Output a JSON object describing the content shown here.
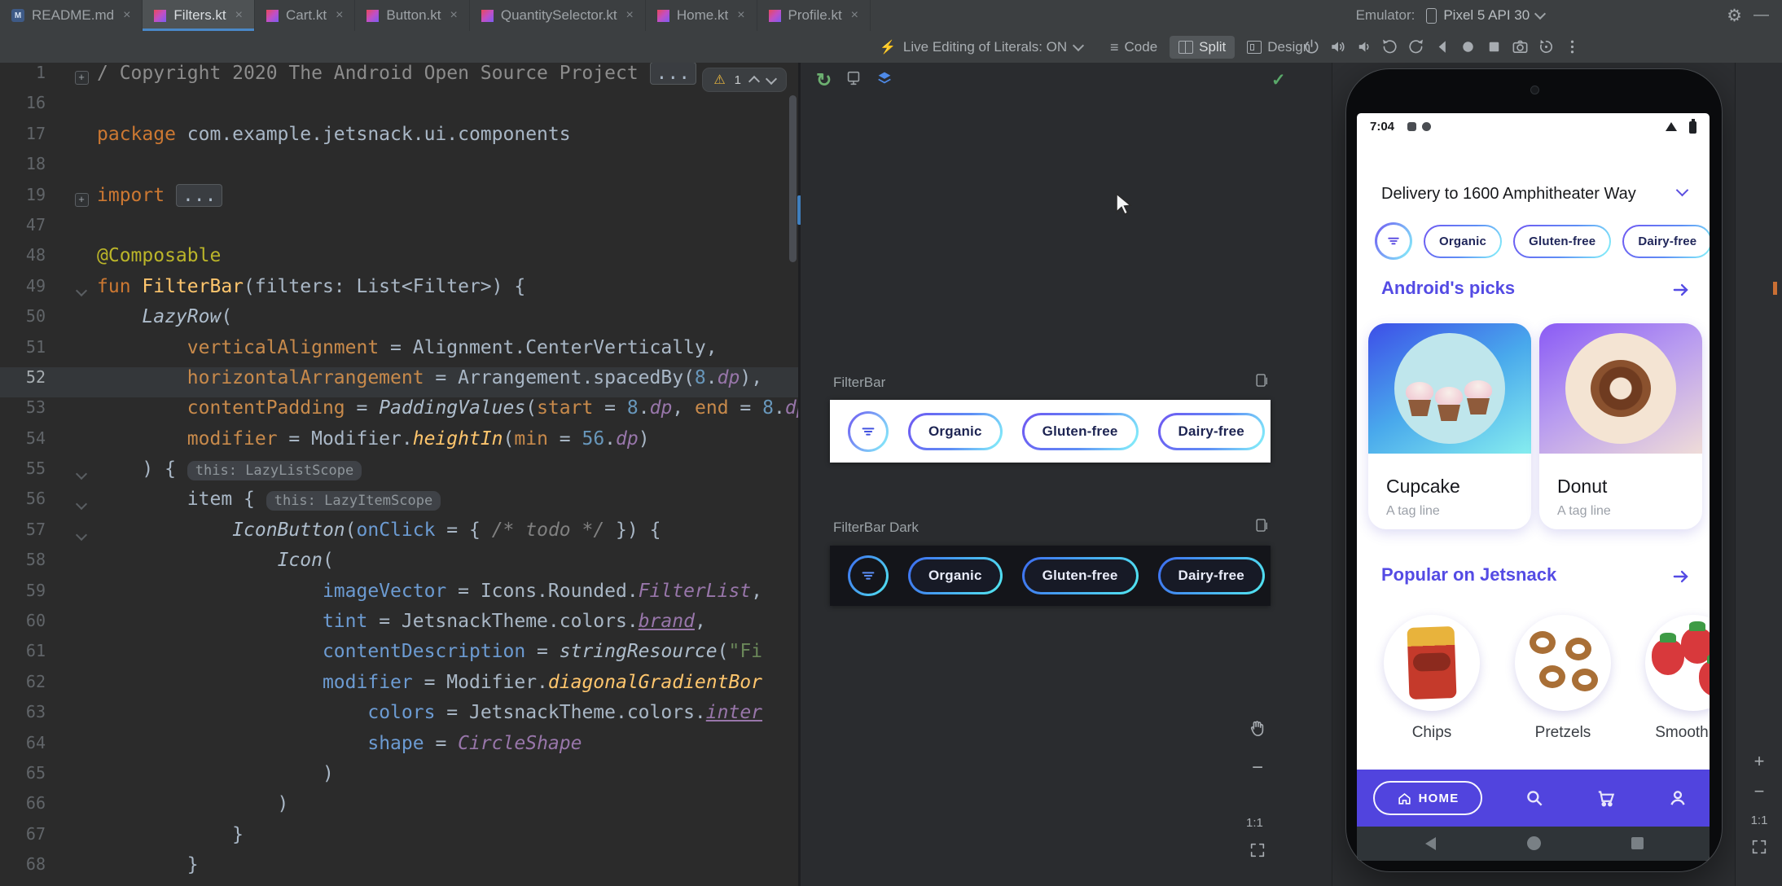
{
  "window": {
    "emulator_label": "Emulator:",
    "device_name": "Pixel 5 API 30"
  },
  "tabs": [
    {
      "label": "README.md",
      "icon": "markdown",
      "active": false
    },
    {
      "label": "Filters.kt",
      "icon": "kotlin",
      "active": true
    },
    {
      "label": "Cart.kt",
      "icon": "kotlin",
      "active": false
    },
    {
      "label": "Button.kt",
      "icon": "kotlin",
      "active": false
    },
    {
      "label": "QuantitySelector.kt",
      "icon": "kotlin",
      "active": false
    },
    {
      "label": "Home.kt",
      "icon": "kotlin",
      "active": false
    },
    {
      "label": "Profile.kt",
      "icon": "kotlin",
      "active": false
    }
  ],
  "toolbar": {
    "live_edit_label": "Live Editing of Literals: ON",
    "view_modes": [
      {
        "label": "Code"
      },
      {
        "label": "Split"
      },
      {
        "label": "Design"
      }
    ],
    "emulator_controls": [
      "power",
      "volume-up",
      "volume-down",
      "rotate-left",
      "rotate-right",
      "back",
      "home",
      "overview",
      "camera",
      "snapshot",
      "more"
    ]
  },
  "editor": {
    "problems_count": "1",
    "lines": [
      {
        "n": "1",
        "g": "plus",
        "t": [
          [
            "cmt",
            "/ Copyright 2020 The Android Open Source Project "
          ],
          [
            "fold",
            "..."
          ]
        ]
      },
      {
        "n": "16",
        "t": []
      },
      {
        "n": "17",
        "t": [
          [
            "kw",
            "package "
          ],
          [
            "plain",
            "com.example.jetsnack.ui.components"
          ]
        ]
      },
      {
        "n": "18",
        "t": []
      },
      {
        "n": "19",
        "g": "plus",
        "t": [
          [
            "kw",
            "import "
          ],
          [
            "fold",
            "..."
          ]
        ]
      },
      {
        "n": "47",
        "t": []
      },
      {
        "n": "48",
        "t": [
          [
            "ann",
            "@Composable"
          ]
        ]
      },
      {
        "n": "49",
        "g": "chev",
        "t": [
          [
            "kw",
            "fun "
          ],
          [
            "fn",
            "FilterBar"
          ],
          [
            "plain",
            "(filters: List<Filter>) {"
          ]
        ]
      },
      {
        "n": "50",
        "t": [
          [
            "plain",
            "    "
          ],
          [
            "comp",
            "LazyRow"
          ],
          [
            "plain",
            "("
          ]
        ]
      },
      {
        "n": "51",
        "t": [
          [
            "plain",
            "        "
          ],
          [
            "named",
            "verticalAlignment"
          ],
          [
            "plain",
            " = Alignment.CenterVertically,"
          ]
        ]
      },
      {
        "n": "52",
        "cur": true,
        "t": [
          [
            "plain",
            "        "
          ],
          [
            "named",
            "horizontalArrangement"
          ],
          [
            "plain",
            " = Arrangement.spacedBy("
          ],
          [
            "num",
            "8"
          ],
          [
            "plain",
            "."
          ],
          [
            "prop",
            "dp"
          ],
          [
            "plain",
            "),"
          ]
        ]
      },
      {
        "n": "53",
        "t": [
          [
            "plain",
            "        "
          ],
          [
            "named",
            "contentPadding"
          ],
          [
            "plain",
            " = "
          ],
          [
            "comp",
            "PaddingValues"
          ],
          [
            "plain",
            "("
          ],
          [
            "named",
            "start"
          ],
          [
            "plain",
            " = "
          ],
          [
            "num",
            "8"
          ],
          [
            "plain",
            "."
          ],
          [
            "prop",
            "dp"
          ],
          [
            "plain",
            ", "
          ],
          [
            "named",
            "end"
          ],
          [
            "plain",
            " = "
          ],
          [
            "num",
            "8"
          ],
          [
            "plain",
            "."
          ],
          [
            "prop",
            "dp"
          ],
          [
            "plain",
            ")"
          ]
        ]
      },
      {
        "n": "54",
        "t": [
          [
            "plain",
            "        "
          ],
          [
            "named",
            "modifier"
          ],
          [
            "plain",
            " = Modifier."
          ],
          [
            "ext",
            "heightIn"
          ],
          [
            "plain",
            "("
          ],
          [
            "named",
            "min"
          ],
          [
            "plain",
            " = "
          ],
          [
            "num",
            "56"
          ],
          [
            "plain",
            "."
          ],
          [
            "prop",
            "dp"
          ],
          [
            "plain",
            ")"
          ]
        ]
      },
      {
        "n": "55",
        "g": "chev",
        "t": [
          [
            "plain",
            "    ) { "
          ],
          [
            "hint",
            "this: LazyListScope"
          ]
        ]
      },
      {
        "n": "56",
        "g": "chev",
        "t": [
          [
            "plain",
            "        item { "
          ],
          [
            "hint",
            "this: LazyItemScope"
          ]
        ]
      },
      {
        "n": "57",
        "g": "chev",
        "t": [
          [
            "plain",
            "            "
          ],
          [
            "comp",
            "IconButton"
          ],
          [
            "plain",
            "("
          ],
          [
            "namedb",
            "onClick"
          ],
          [
            "plain",
            " = { "
          ],
          [
            "cmti",
            "/* todo */"
          ],
          [
            "plain",
            " }) {"
          ]
        ]
      },
      {
        "n": "58",
        "t": [
          [
            "plain",
            "                "
          ],
          [
            "comp",
            "Icon"
          ],
          [
            "plain",
            "("
          ]
        ]
      },
      {
        "n": "59",
        "t": [
          [
            "plain",
            "                    "
          ],
          [
            "namedb",
            "imageVector"
          ],
          [
            "plain",
            " = Icons.Rounded."
          ],
          [
            "prop",
            "FilterList"
          ],
          [
            "plain",
            ","
          ]
        ]
      },
      {
        "n": "60",
        "t": [
          [
            "plain",
            "                    "
          ],
          [
            "namedb",
            "tint"
          ],
          [
            "plain",
            " = JetsnackTheme.colors."
          ],
          [
            "propu",
            "brand"
          ],
          [
            "plain",
            ","
          ]
        ]
      },
      {
        "n": "61",
        "t": [
          [
            "plain",
            "                    "
          ],
          [
            "namedb",
            "contentDescription"
          ],
          [
            "plain",
            " = "
          ],
          [
            "comp",
            "stringResource"
          ],
          [
            "plain",
            "("
          ],
          [
            "str",
            "\"Fi"
          ]
        ]
      },
      {
        "n": "62",
        "t": [
          [
            "plain",
            "                    "
          ],
          [
            "namedb",
            "modifier"
          ],
          [
            "plain",
            " = Modifier."
          ],
          [
            "ext",
            "diagonalGradientBor"
          ]
        ]
      },
      {
        "n": "63",
        "t": [
          [
            "plain",
            "                        "
          ],
          [
            "namedb",
            "colors"
          ],
          [
            "plain",
            " = JetsnackTheme.colors."
          ],
          [
            "propu",
            "inter"
          ]
        ]
      },
      {
        "n": "64",
        "t": [
          [
            "plain",
            "                        "
          ],
          [
            "namedb",
            "shape"
          ],
          [
            "plain",
            " = "
          ],
          [
            "prop",
            "CircleShape"
          ]
        ]
      },
      {
        "n": "65",
        "t": [
          [
            "plain",
            "                    )"
          ]
        ]
      },
      {
        "n": "66",
        "t": [
          [
            "plain",
            "                )"
          ]
        ]
      },
      {
        "n": "67",
        "t": [
          [
            "plain",
            "            }"
          ]
        ]
      },
      {
        "n": "68",
        "t": [
          [
            "plain",
            "        }"
          ]
        ]
      }
    ]
  },
  "preview": {
    "sections": [
      {
        "title": "FilterBar",
        "theme": "light",
        "chips": [
          "Organic",
          "Gluten-free",
          "Dairy-free"
        ]
      },
      {
        "title": "FilterBar Dark",
        "theme": "dark",
        "chips": [
          "Organic",
          "Gluten-free",
          "Dairy-free"
        ]
      }
    ],
    "zoom": {
      "zoom_out": "−",
      "one_to_one": "1:1"
    }
  },
  "emulator_panel": {
    "zoom": {
      "zoom_in": "+",
      "zoom_out": "−",
      "one_to_one": "1:1"
    }
  },
  "phone": {
    "status_time": "7:04",
    "delivery_text": "Delivery to 1600 Amphitheater Way",
    "filter_chips": [
      "Organic",
      "Gluten-free",
      "Dairy-free"
    ],
    "sections": [
      {
        "title": "Android's picks"
      },
      {
        "title": "Popular on Jetsnack"
      }
    ],
    "cards": [
      {
        "title": "Cupcake",
        "subtitle": "A tag line",
        "image": "cupcake"
      },
      {
        "title": "Donut",
        "subtitle": "A tag line",
        "image": "donut"
      }
    ],
    "snacks": [
      {
        "label": "Chips",
        "image": "chips"
      },
      {
        "label": "Pretzels",
        "image": "pretzels"
      },
      {
        "label": "Smooth",
        "image": "smoothie"
      }
    ],
    "bottom_nav": {
      "home_label": "HOME"
    }
  },
  "icons": {
    "legend": [
      "power-icon",
      "volume-up-icon",
      "volume-down-icon",
      "rotate-left-icon",
      "rotate-right-icon",
      "back-icon",
      "home-icon",
      "overview-icon",
      "camera-icon",
      "snapshot-icon",
      "more-icon",
      "gear-icon",
      "minimize-icon",
      "filter-icon",
      "search-icon",
      "cart-icon",
      "profile-icon",
      "arrow-right-icon",
      "chevron-down-icon",
      "check-icon",
      "refresh-icon",
      "layers-icon",
      "warning-icon",
      "hand-icon",
      "fit-screen-icon"
    ]
  },
  "colors": {
    "accent_blue": "#4A88C7",
    "brand_purple": "#544BE4",
    "chip_gradient_start": "#6F57F2",
    "chip_gradient_end": "#86F7FA",
    "nav_background": "#5144DE",
    "editor_bg": "#2B2B2B"
  }
}
